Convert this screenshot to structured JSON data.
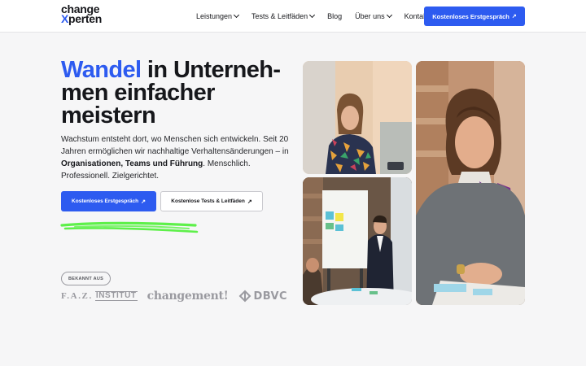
{
  "header": {
    "logo": {
      "line1": "change",
      "line2_accent": "X",
      "line2_rest": "perten"
    },
    "nav": [
      {
        "label": "Leistungen",
        "has_dropdown": true
      },
      {
        "label": "Tests & Leitfäden",
        "has_dropdown": true
      },
      {
        "label": "Blog",
        "has_dropdown": false
      },
      {
        "label": "Über uns",
        "has_dropdown": true
      },
      {
        "label": "Kontakt",
        "has_dropdown": false
      }
    ],
    "cta": {
      "label": "Kostenloses Erstgespräch",
      "arrow": "↗"
    }
  },
  "hero": {
    "headline_accent": "Wandel",
    "headline_rest": " in Unterneh-men einfacher meistern",
    "lead_part1": "Wachstum entsteht dort, wo Menschen sich entwickeln. Seit 20 Jahren ermöglichen wir nachhaltige Verhaltensänderungen – in ",
    "lead_bold": "Organisationen, Teams und Führung",
    "lead_part2": ". Menschlich. Professionell. Zielgerichtet.",
    "primary_button": {
      "label": "Kostenloses Erstgespräch",
      "arrow": "↗"
    },
    "secondary_button": {
      "label": "Kostenlose Tests & Leitfäden",
      "arrow": "↗"
    }
  },
  "press": {
    "badge": "BEKANNT AUS",
    "logos": [
      {
        "name": "faz-institut-logo",
        "text_a": "F.A.Z.",
        "text_b": "INSTITUT"
      },
      {
        "name": "changement-logo",
        "text_a": "changement!"
      },
      {
        "name": "dbvc-logo",
        "text_a": "DBVC"
      }
    ]
  },
  "colors": {
    "accent": "#2d5bf0",
    "text": "#16171b",
    "highlight": "#5ef04a",
    "logo_gray": "#9a9aa0"
  }
}
